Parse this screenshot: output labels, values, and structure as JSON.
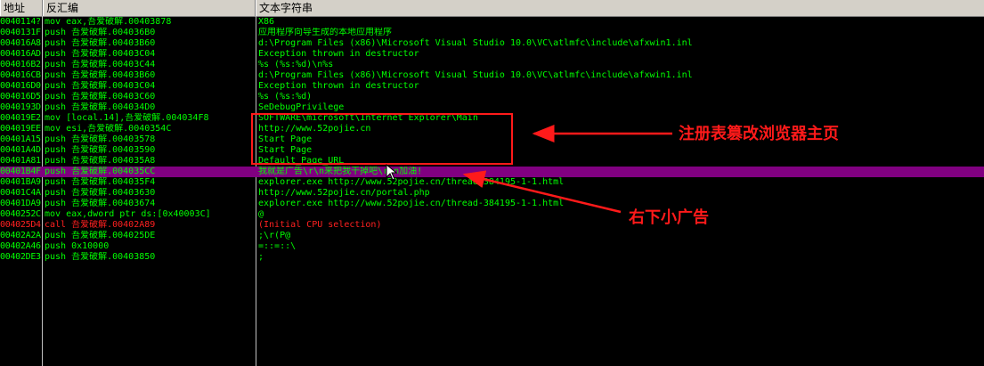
{
  "columns": {
    "address": "地址",
    "disassembly": "反汇编",
    "text_string": "文本字符串"
  },
  "rows": [
    {
      "address": "0040114?",
      "disasm": "mov eax,吾爱破解.00403878",
      "text": "X86"
    },
    {
      "address": "0040131F",
      "disasm": "push 吾爱破解.004036B0",
      "text": "应用程序向导生成的本地应用程序"
    },
    {
      "address": "004016A8",
      "disasm": "push 吾爱破解.00403B60",
      "text": "d:\\Program Files (x86)\\Microsoft Visual Studio 10.0\\VC\\atlmfc\\include\\afxwin1.inl"
    },
    {
      "address": "004016AD",
      "disasm": "push 吾爱破解.00403C04",
      "text": "Exception thrown in destructor"
    },
    {
      "address": "004016B2",
      "disasm": "push 吾爱破解.00403C44",
      "text": "%s (%s:%d)\\n%s"
    },
    {
      "address": "004016CB",
      "disasm": "push 吾爱破解.00403B60",
      "text": "d:\\Program Files (x86)\\Microsoft Visual Studio 10.0\\VC\\atlmfc\\include\\afxwin1.inl"
    },
    {
      "address": "004016D0",
      "disasm": "push 吾爱破解.00403C04",
      "text": "Exception thrown in destructor"
    },
    {
      "address": "004016D5",
      "disasm": "push 吾爱破解.00403C60",
      "text": "%s (%s:%d)"
    },
    {
      "address": "0040193D",
      "disasm": "push 吾爱破解.004034D0",
      "text": "SeDebugPrivilege"
    },
    {
      "address": "004019E2",
      "disasm": "mov [local.14],吾爱破解.004034F8",
      "text": "SOFTWARE\\microsoft\\Internet Explorer\\Main"
    },
    {
      "address": "004019EE",
      "disasm": "mov esi,吾爱破解.0040354C",
      "text": "http://www.52pojie.cn"
    },
    {
      "address": "00401A15",
      "disasm": "push 吾爱破解.00403578",
      "text": "Start Page"
    },
    {
      "address": "00401A4D",
      "disasm": "push 吾爱破解.00403590",
      "text": "Start Page"
    },
    {
      "address": "00401A81",
      "disasm": "push 吾爱破解.004035A8",
      "text": "Default_Page_URL"
    },
    {
      "address": "00401B4F",
      "disasm": "push 吾爱破解.004035CC",
      "text": "我就是广告\\r\\n来把我干掉吧\\r\\n加油!",
      "selected": true
    },
    {
      "address": "00401BA9",
      "disasm": "push 吾爱破解.004035F4",
      "text": "explorer.exe http://www.52pojie.cn/thread-384195-1-1.html"
    },
    {
      "address": "00401C4A",
      "disasm": "push 吾爱破解.00403630",
      "text": "http://www.52pojie.cn/portal.php"
    },
    {
      "address": "00401DA9",
      "disasm": "push 吾爱破解.00403674",
      "text": "explorer.exe http://www.52pojie.cn/thread-384195-1-1.html"
    },
    {
      "address": "0040252C",
      "disasm": "mov eax,dword ptr ds:[0x40003C]",
      "text": "@"
    },
    {
      "address": "004025D4",
      "disasm": "call 吾爱破解.00402A89",
      "text": "(Initial CPU selection)",
      "red": true
    },
    {
      "address": "00402A2A",
      "disasm": "push 吾爱破解.004025DE",
      "text": ";\\r(P@"
    },
    {
      "address": "00402A46",
      "disasm": "push 0x10000",
      "text": "=::=::\\"
    },
    {
      "address": "00402DE3",
      "disasm": "push 吾爱破解.00403850",
      "text": ";"
    }
  ],
  "annotations": {
    "registry": "注册表篡改浏览器主页",
    "ad": "右下小广告"
  },
  "colors": {
    "text": "#00ff00",
    "highlight": "#800080",
    "annotation": "#ff1a1a",
    "background": "#000000"
  }
}
